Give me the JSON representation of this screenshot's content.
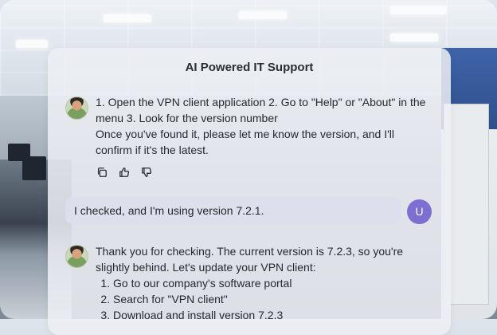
{
  "header": {
    "title": "AI Powered IT Support"
  },
  "messages": {
    "bot1": {
      "line1": "1. Open the VPN client application 2. Go to \"Help\" or \"About\" in the",
      "line2": "menu 3. Look for the version number",
      "line3": "Once you've found it, please let me know the version, and I'll",
      "line4": "confirm if it's the latest."
    },
    "user1": {
      "text": "I checked, and I'm using version 7.2.1.",
      "avatar_initial": "U"
    },
    "bot2": {
      "line1": "Thank you for checking. The current version is 7.2.3, so you're",
      "line2": "slightly behind. Let's update your VPN client:",
      "steps": [
        "Go to our company's software portal",
        "Search for \"VPN client\"",
        "Download and install version 7.2.3"
      ]
    }
  },
  "actions": {
    "icons": [
      "copy-icon",
      "thumbs-up-icon",
      "thumbs-down-icon"
    ]
  },
  "colors": {
    "user_avatar": "#7d6fd1",
    "user_bubble": "#dddeec",
    "panel": "#eceff3"
  }
}
